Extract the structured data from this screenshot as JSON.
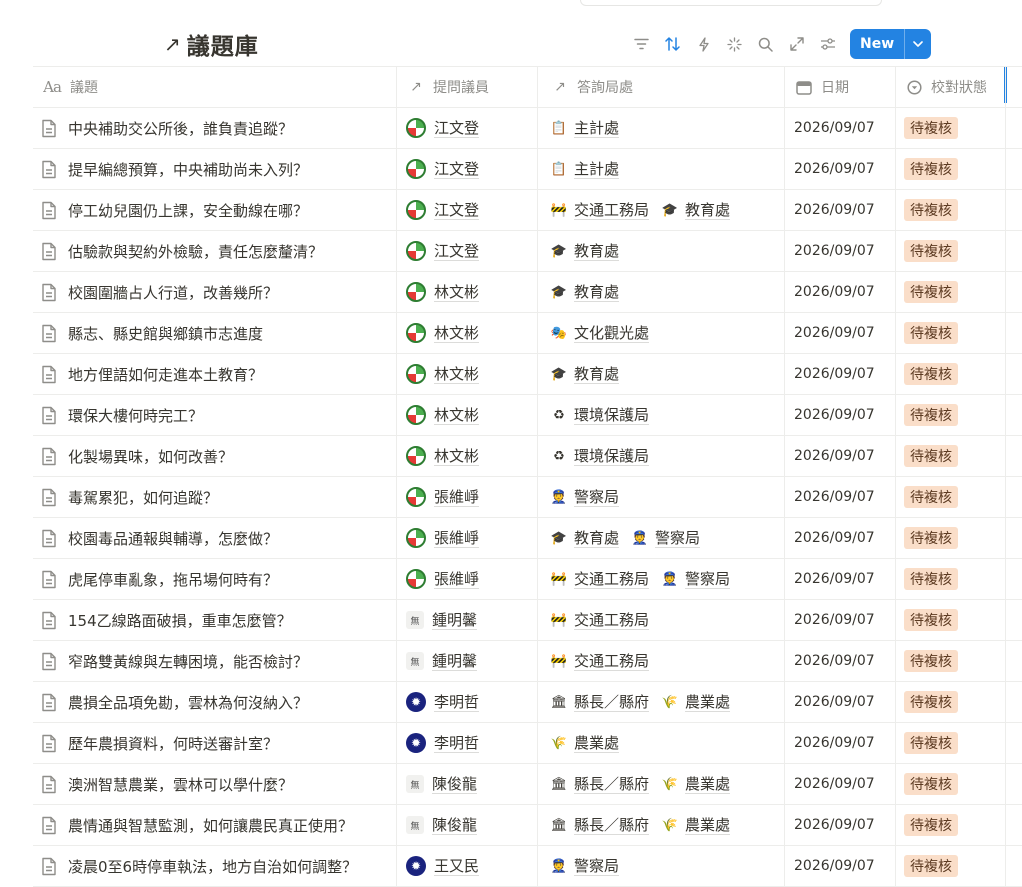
{
  "title": {
    "arrow": "↗",
    "text": "議題庫"
  },
  "toolbar": {
    "new_label": "New"
  },
  "columns": [
    {
      "icon": "Aa",
      "label": "議題"
    },
    {
      "icon": "↗",
      "label": "提問議員"
    },
    {
      "icon": "↗",
      "label": "答詢局處"
    },
    {
      "icon": "📅",
      "label": "日期"
    },
    {
      "icon": "◉",
      "label": "校對狀態"
    }
  ],
  "rows": [
    {
      "topic": "中央補助交公所後，誰負責追蹤？",
      "member": "江文登",
      "party": "dpp",
      "depts": [
        {
          "emoji": "📋",
          "name": "主計處"
        }
      ],
      "date": "2026/09/07",
      "status": "待複核"
    },
    {
      "topic": "提早編總預算，中央補助尚未入列？",
      "member": "江文登",
      "party": "dpp",
      "depts": [
        {
          "emoji": "📋",
          "name": "主計處"
        }
      ],
      "date": "2026/09/07",
      "status": "待複核"
    },
    {
      "topic": "停工幼兒園仍上課，安全動線在哪？",
      "member": "江文登",
      "party": "dpp",
      "depts": [
        {
          "emoji": "🚧",
          "name": "交通工務局"
        },
        {
          "emoji": "🎓",
          "name": "教育處"
        }
      ],
      "date": "2026/09/07",
      "status": "待複核"
    },
    {
      "topic": "估驗款與契約外檢驗，責任怎麼釐清？",
      "member": "江文登",
      "party": "dpp",
      "depts": [
        {
          "emoji": "🎓",
          "name": "教育處"
        }
      ],
      "date": "2026/09/07",
      "status": "待複核"
    },
    {
      "topic": "校園圍牆占人行道，改善幾所？",
      "member": "林文彬",
      "party": "dpp",
      "depts": [
        {
          "emoji": "🎓",
          "name": "教育處"
        }
      ],
      "date": "2026/09/07",
      "status": "待複核"
    },
    {
      "topic": "縣志、縣史館與鄉鎮市志進度",
      "member": "林文彬",
      "party": "dpp",
      "depts": [
        {
          "emoji": "🎭",
          "name": "文化觀光處"
        }
      ],
      "date": "2026/09/07",
      "status": "待複核"
    },
    {
      "topic": "地方俚語如何走進本土教育？",
      "member": "林文彬",
      "party": "dpp",
      "depts": [
        {
          "emoji": "🎓",
          "name": "教育處"
        }
      ],
      "date": "2026/09/07",
      "status": "待複核"
    },
    {
      "topic": "環保大樓何時完工？",
      "member": "林文彬",
      "party": "dpp",
      "depts": [
        {
          "emoji": "♻",
          "name": "環境保護局"
        }
      ],
      "date": "2026/09/07",
      "status": "待複核"
    },
    {
      "topic": "化製場異味，如何改善？",
      "member": "林文彬",
      "party": "dpp",
      "depts": [
        {
          "emoji": "♻",
          "name": "環境保護局"
        }
      ],
      "date": "2026/09/07",
      "status": "待複核"
    },
    {
      "topic": "毒駕累犯，如何追蹤？",
      "member": "張維崢",
      "party": "dpp",
      "depts": [
        {
          "emoji": "👮",
          "name": "警察局"
        }
      ],
      "date": "2026/09/07",
      "status": "待複核"
    },
    {
      "topic": "校園毒品通報與輔導，怎麼做？",
      "member": "張維崢",
      "party": "dpp",
      "depts": [
        {
          "emoji": "🎓",
          "name": "教育處"
        },
        {
          "emoji": "👮",
          "name": "警察局"
        }
      ],
      "date": "2026/09/07",
      "status": "待複核"
    },
    {
      "topic": "虎尾停車亂象，拖吊場何時有？",
      "member": "張維崢",
      "party": "dpp",
      "depts": [
        {
          "emoji": "🚧",
          "name": "交通工務局"
        },
        {
          "emoji": "👮",
          "name": "警察局"
        }
      ],
      "date": "2026/09/07",
      "status": "待複核"
    },
    {
      "topic": "154乙線路面破損，重車怎麼管？",
      "member": "鍾明馨",
      "party": "ind",
      "depts": [
        {
          "emoji": "🚧",
          "name": "交通工務局"
        }
      ],
      "date": "2026/09/07",
      "status": "待複核"
    },
    {
      "topic": "窄路雙黃線與左轉困境，能否檢討？",
      "member": "鍾明馨",
      "party": "ind",
      "depts": [
        {
          "emoji": "🚧",
          "name": "交通工務局"
        }
      ],
      "date": "2026/09/07",
      "status": "待複核"
    },
    {
      "topic": "農損全品項免勘，雲林為何沒納入？",
      "member": "李明哲",
      "party": "kmt",
      "depts": [
        {
          "emoji": "🏛",
          "name": "縣長／縣府"
        },
        {
          "emoji": "🌾",
          "name": "農業處"
        }
      ],
      "date": "2026/09/07",
      "status": "待複核"
    },
    {
      "topic": "歷年農損資料，何時送審計室？",
      "member": "李明哲",
      "party": "kmt",
      "depts": [
        {
          "emoji": "🌾",
          "name": "農業處"
        }
      ],
      "date": "2026/09/07",
      "status": "待複核"
    },
    {
      "topic": "澳洲智慧農業，雲林可以學什麼？",
      "member": "陳俊龍",
      "party": "ind",
      "depts": [
        {
          "emoji": "🏛",
          "name": "縣長／縣府"
        },
        {
          "emoji": "🌾",
          "name": "農業處"
        }
      ],
      "date": "2026/09/07",
      "status": "待複核"
    },
    {
      "topic": "農情通與智慧監測，如何讓農民真正使用？",
      "member": "陳俊龍",
      "party": "ind",
      "depts": [
        {
          "emoji": "🏛",
          "name": "縣長／縣府"
        },
        {
          "emoji": "🌾",
          "name": "農業處"
        }
      ],
      "date": "2026/09/07",
      "status": "待複核"
    },
    {
      "topic": "凌晨0至6時停車執法，地方自治如何調整？",
      "member": "王又民",
      "party": "kmt",
      "depts": [
        {
          "emoji": "👮",
          "name": "警察局"
        }
      ],
      "date": "2026/09/07",
      "status": "待複核"
    }
  ]
}
